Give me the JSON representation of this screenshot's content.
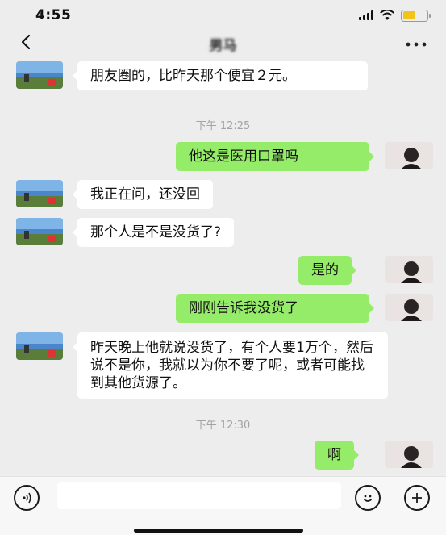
{
  "status": {
    "time": "4:55"
  },
  "header": {
    "title": "男马"
  },
  "colors": {
    "background": "#ededed",
    "outgoing_bubble": "#95ec69",
    "incoming_bubble": "#ffffff",
    "timestamp": "#a3a3a3"
  },
  "icons": {
    "back": "chevron-left-icon",
    "more": "ellipsis-icon",
    "voice": "voice-icon",
    "emoji": "emoji-icon",
    "plus": "plus-icon"
  },
  "messages": [
    {
      "side": "in",
      "text": "朋友圈的，比昨天那个便宜２元。"
    },
    {
      "type": "time",
      "text": "下午 12:25"
    },
    {
      "side": "out",
      "text": "他这是医用口罩吗"
    },
    {
      "side": "in",
      "text": "我正在问，还没回"
    },
    {
      "side": "in",
      "text": "那个人是不是没货了?"
    },
    {
      "side": "out",
      "text": "是的"
    },
    {
      "side": "out",
      "text": "刚刚告诉我没货了"
    },
    {
      "side": "in",
      "text": "昨天晚上他就说没货了，有个人要1万个，然后说不是你，我就以为你不要了呢，或者可能找到其他货源了。"
    },
    {
      "type": "time",
      "text": "下午 12:30"
    },
    {
      "side": "out",
      "text": "啊"
    }
  ],
  "input": {
    "value": "",
    "placeholder": ""
  }
}
